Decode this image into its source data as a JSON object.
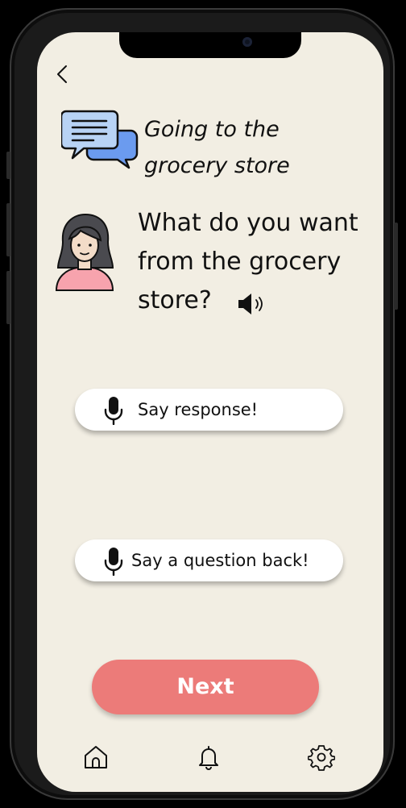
{
  "header": {
    "title": "Going to the grocery store"
  },
  "prompt": {
    "question": "What do you want from the grocery store?"
  },
  "responses": {
    "say_response_label": "Say response!",
    "say_question_label": "Say a question back!"
  },
  "actions": {
    "next_label": "Next"
  },
  "colors": {
    "background": "#f2eee3",
    "next_button": "#ec7b79",
    "chat_bubble_back": "#6b9bef",
    "chat_bubble_front": "#b8d3f5",
    "avatar_shirt": "#f7a3ad"
  },
  "icons": {
    "back": "chevron-left-icon",
    "chat": "chat-bubbles-icon",
    "avatar": "woman-avatar-icon",
    "speaker": "speaker-icon",
    "mic": "microphone-icon",
    "home": "home-icon",
    "notifications": "bell-icon",
    "settings": "gear-icon"
  }
}
